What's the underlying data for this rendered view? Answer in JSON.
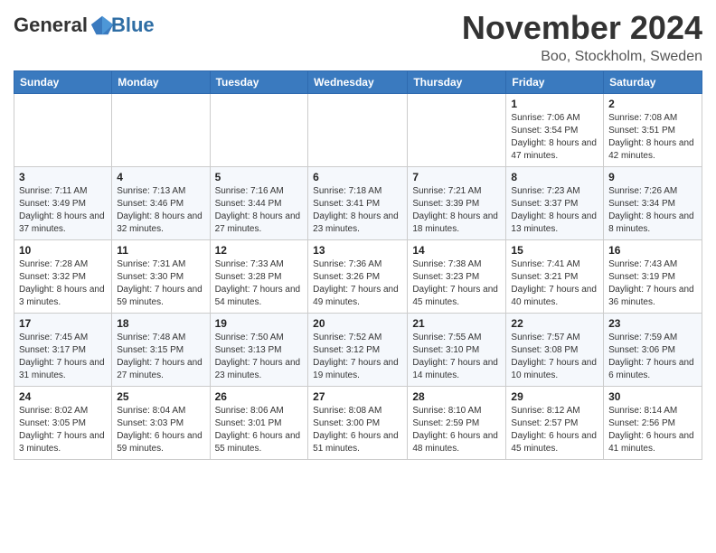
{
  "logo": {
    "text_general": "General",
    "text_blue": "Blue"
  },
  "title": "November 2024",
  "location": "Boo, Stockholm, Sweden",
  "weekdays": [
    "Sunday",
    "Monday",
    "Tuesday",
    "Wednesday",
    "Thursday",
    "Friday",
    "Saturday"
  ],
  "weeks": [
    [
      {
        "day": "",
        "info": ""
      },
      {
        "day": "",
        "info": ""
      },
      {
        "day": "",
        "info": ""
      },
      {
        "day": "",
        "info": ""
      },
      {
        "day": "",
        "info": ""
      },
      {
        "day": "1",
        "info": "Sunrise: 7:06 AM\nSunset: 3:54 PM\nDaylight: 8 hours and 47 minutes."
      },
      {
        "day": "2",
        "info": "Sunrise: 7:08 AM\nSunset: 3:51 PM\nDaylight: 8 hours and 42 minutes."
      }
    ],
    [
      {
        "day": "3",
        "info": "Sunrise: 7:11 AM\nSunset: 3:49 PM\nDaylight: 8 hours and 37 minutes."
      },
      {
        "day": "4",
        "info": "Sunrise: 7:13 AM\nSunset: 3:46 PM\nDaylight: 8 hours and 32 minutes."
      },
      {
        "day": "5",
        "info": "Sunrise: 7:16 AM\nSunset: 3:44 PM\nDaylight: 8 hours and 27 minutes."
      },
      {
        "day": "6",
        "info": "Sunrise: 7:18 AM\nSunset: 3:41 PM\nDaylight: 8 hours and 23 minutes."
      },
      {
        "day": "7",
        "info": "Sunrise: 7:21 AM\nSunset: 3:39 PM\nDaylight: 8 hours and 18 minutes."
      },
      {
        "day": "8",
        "info": "Sunrise: 7:23 AM\nSunset: 3:37 PM\nDaylight: 8 hours and 13 minutes."
      },
      {
        "day": "9",
        "info": "Sunrise: 7:26 AM\nSunset: 3:34 PM\nDaylight: 8 hours and 8 minutes."
      }
    ],
    [
      {
        "day": "10",
        "info": "Sunrise: 7:28 AM\nSunset: 3:32 PM\nDaylight: 8 hours and 3 minutes."
      },
      {
        "day": "11",
        "info": "Sunrise: 7:31 AM\nSunset: 3:30 PM\nDaylight: 7 hours and 59 minutes."
      },
      {
        "day": "12",
        "info": "Sunrise: 7:33 AM\nSunset: 3:28 PM\nDaylight: 7 hours and 54 minutes."
      },
      {
        "day": "13",
        "info": "Sunrise: 7:36 AM\nSunset: 3:26 PM\nDaylight: 7 hours and 49 minutes."
      },
      {
        "day": "14",
        "info": "Sunrise: 7:38 AM\nSunset: 3:23 PM\nDaylight: 7 hours and 45 minutes."
      },
      {
        "day": "15",
        "info": "Sunrise: 7:41 AM\nSunset: 3:21 PM\nDaylight: 7 hours and 40 minutes."
      },
      {
        "day": "16",
        "info": "Sunrise: 7:43 AM\nSunset: 3:19 PM\nDaylight: 7 hours and 36 minutes."
      }
    ],
    [
      {
        "day": "17",
        "info": "Sunrise: 7:45 AM\nSunset: 3:17 PM\nDaylight: 7 hours and 31 minutes."
      },
      {
        "day": "18",
        "info": "Sunrise: 7:48 AM\nSunset: 3:15 PM\nDaylight: 7 hours and 27 minutes."
      },
      {
        "day": "19",
        "info": "Sunrise: 7:50 AM\nSunset: 3:13 PM\nDaylight: 7 hours and 23 minutes."
      },
      {
        "day": "20",
        "info": "Sunrise: 7:52 AM\nSunset: 3:12 PM\nDaylight: 7 hours and 19 minutes."
      },
      {
        "day": "21",
        "info": "Sunrise: 7:55 AM\nSunset: 3:10 PM\nDaylight: 7 hours and 14 minutes."
      },
      {
        "day": "22",
        "info": "Sunrise: 7:57 AM\nSunset: 3:08 PM\nDaylight: 7 hours and 10 minutes."
      },
      {
        "day": "23",
        "info": "Sunrise: 7:59 AM\nSunset: 3:06 PM\nDaylight: 7 hours and 6 minutes."
      }
    ],
    [
      {
        "day": "24",
        "info": "Sunrise: 8:02 AM\nSunset: 3:05 PM\nDaylight: 7 hours and 3 minutes."
      },
      {
        "day": "25",
        "info": "Sunrise: 8:04 AM\nSunset: 3:03 PM\nDaylight: 6 hours and 59 minutes."
      },
      {
        "day": "26",
        "info": "Sunrise: 8:06 AM\nSunset: 3:01 PM\nDaylight: 6 hours and 55 minutes."
      },
      {
        "day": "27",
        "info": "Sunrise: 8:08 AM\nSunset: 3:00 PM\nDaylight: 6 hours and 51 minutes."
      },
      {
        "day": "28",
        "info": "Sunrise: 8:10 AM\nSunset: 2:59 PM\nDaylight: 6 hours and 48 minutes."
      },
      {
        "day": "29",
        "info": "Sunrise: 8:12 AM\nSunset: 2:57 PM\nDaylight: 6 hours and 45 minutes."
      },
      {
        "day": "30",
        "info": "Sunrise: 8:14 AM\nSunset: 2:56 PM\nDaylight: 6 hours and 41 minutes."
      }
    ]
  ]
}
